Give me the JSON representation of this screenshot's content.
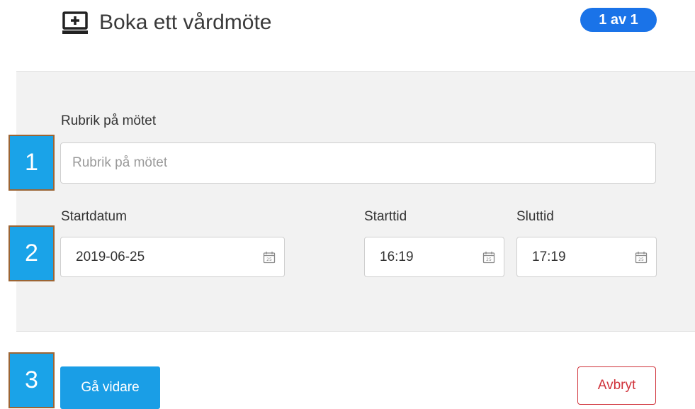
{
  "header": {
    "icon": "monitor-plus-icon",
    "title": "Boka ett vårdmöte",
    "step_badge": "1 av 1"
  },
  "form": {
    "title_field": {
      "label": "Rubrik på mötet",
      "value": "",
      "placeholder": "Rubrik på mötet"
    },
    "start_date": {
      "label": "Startdatum",
      "value": "2019-06-25",
      "icon": "calendar-icon"
    },
    "start_time": {
      "label": "Starttid",
      "value": "16:19",
      "icon": "calendar-icon"
    },
    "end_time": {
      "label": "Sluttid",
      "value": "17:19",
      "icon": "calendar-icon"
    }
  },
  "callouts": [
    "1",
    "2",
    "3"
  ],
  "buttons": {
    "continue": "Gå vidare",
    "cancel": "Avbryt"
  },
  "colors": {
    "badge": "#1a73e8",
    "primary_button": "#1a9ee6",
    "cancel": "#d0323a",
    "panel": "#f2f2f2",
    "callout_fill": "#1aa3e8",
    "callout_border": "#9c6534"
  }
}
